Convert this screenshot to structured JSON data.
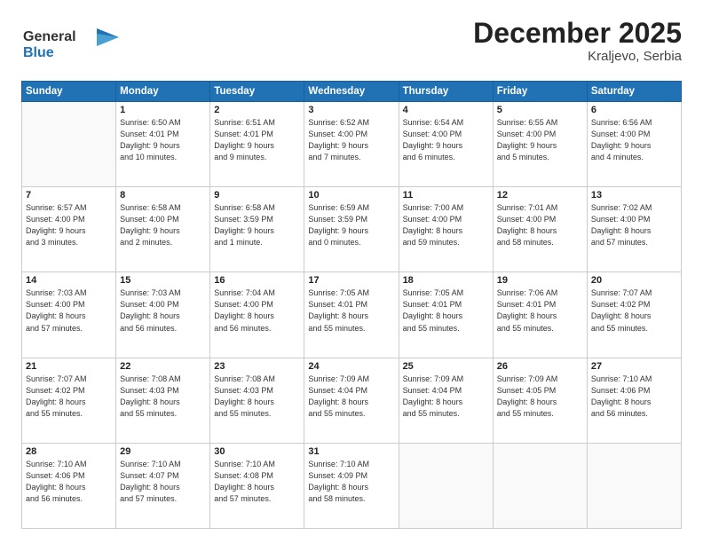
{
  "header": {
    "logo_line1": "General",
    "logo_line2": "Blue",
    "month": "December 2025",
    "location": "Kraljevo, Serbia"
  },
  "weekdays": [
    "Sunday",
    "Monday",
    "Tuesday",
    "Wednesday",
    "Thursday",
    "Friday",
    "Saturday"
  ],
  "weeks": [
    [
      {
        "day": "",
        "info": ""
      },
      {
        "day": "1",
        "info": "Sunrise: 6:50 AM\nSunset: 4:01 PM\nDaylight: 9 hours\nand 10 minutes."
      },
      {
        "day": "2",
        "info": "Sunrise: 6:51 AM\nSunset: 4:01 PM\nDaylight: 9 hours\nand 9 minutes."
      },
      {
        "day": "3",
        "info": "Sunrise: 6:52 AM\nSunset: 4:00 PM\nDaylight: 9 hours\nand 7 minutes."
      },
      {
        "day": "4",
        "info": "Sunrise: 6:54 AM\nSunset: 4:00 PM\nDaylight: 9 hours\nand 6 minutes."
      },
      {
        "day": "5",
        "info": "Sunrise: 6:55 AM\nSunset: 4:00 PM\nDaylight: 9 hours\nand 5 minutes."
      },
      {
        "day": "6",
        "info": "Sunrise: 6:56 AM\nSunset: 4:00 PM\nDaylight: 9 hours\nand 4 minutes."
      }
    ],
    [
      {
        "day": "7",
        "info": "Sunrise: 6:57 AM\nSunset: 4:00 PM\nDaylight: 9 hours\nand 3 minutes."
      },
      {
        "day": "8",
        "info": "Sunrise: 6:58 AM\nSunset: 4:00 PM\nDaylight: 9 hours\nand 2 minutes."
      },
      {
        "day": "9",
        "info": "Sunrise: 6:58 AM\nSunset: 3:59 PM\nDaylight: 9 hours\nand 1 minute."
      },
      {
        "day": "10",
        "info": "Sunrise: 6:59 AM\nSunset: 3:59 PM\nDaylight: 9 hours\nand 0 minutes."
      },
      {
        "day": "11",
        "info": "Sunrise: 7:00 AM\nSunset: 4:00 PM\nDaylight: 8 hours\nand 59 minutes."
      },
      {
        "day": "12",
        "info": "Sunrise: 7:01 AM\nSunset: 4:00 PM\nDaylight: 8 hours\nand 58 minutes."
      },
      {
        "day": "13",
        "info": "Sunrise: 7:02 AM\nSunset: 4:00 PM\nDaylight: 8 hours\nand 57 minutes."
      }
    ],
    [
      {
        "day": "14",
        "info": "Sunrise: 7:03 AM\nSunset: 4:00 PM\nDaylight: 8 hours\nand 57 minutes."
      },
      {
        "day": "15",
        "info": "Sunrise: 7:03 AM\nSunset: 4:00 PM\nDaylight: 8 hours\nand 56 minutes."
      },
      {
        "day": "16",
        "info": "Sunrise: 7:04 AM\nSunset: 4:00 PM\nDaylight: 8 hours\nand 56 minutes."
      },
      {
        "day": "17",
        "info": "Sunrise: 7:05 AM\nSunset: 4:01 PM\nDaylight: 8 hours\nand 55 minutes."
      },
      {
        "day": "18",
        "info": "Sunrise: 7:05 AM\nSunset: 4:01 PM\nDaylight: 8 hours\nand 55 minutes."
      },
      {
        "day": "19",
        "info": "Sunrise: 7:06 AM\nSunset: 4:01 PM\nDaylight: 8 hours\nand 55 minutes."
      },
      {
        "day": "20",
        "info": "Sunrise: 7:07 AM\nSunset: 4:02 PM\nDaylight: 8 hours\nand 55 minutes."
      }
    ],
    [
      {
        "day": "21",
        "info": "Sunrise: 7:07 AM\nSunset: 4:02 PM\nDaylight: 8 hours\nand 55 minutes."
      },
      {
        "day": "22",
        "info": "Sunrise: 7:08 AM\nSunset: 4:03 PM\nDaylight: 8 hours\nand 55 minutes."
      },
      {
        "day": "23",
        "info": "Sunrise: 7:08 AM\nSunset: 4:03 PM\nDaylight: 8 hours\nand 55 minutes."
      },
      {
        "day": "24",
        "info": "Sunrise: 7:09 AM\nSunset: 4:04 PM\nDaylight: 8 hours\nand 55 minutes."
      },
      {
        "day": "25",
        "info": "Sunrise: 7:09 AM\nSunset: 4:04 PM\nDaylight: 8 hours\nand 55 minutes."
      },
      {
        "day": "26",
        "info": "Sunrise: 7:09 AM\nSunset: 4:05 PM\nDaylight: 8 hours\nand 55 minutes."
      },
      {
        "day": "27",
        "info": "Sunrise: 7:10 AM\nSunset: 4:06 PM\nDaylight: 8 hours\nand 56 minutes."
      }
    ],
    [
      {
        "day": "28",
        "info": "Sunrise: 7:10 AM\nSunset: 4:06 PM\nDaylight: 8 hours\nand 56 minutes."
      },
      {
        "day": "29",
        "info": "Sunrise: 7:10 AM\nSunset: 4:07 PM\nDaylight: 8 hours\nand 57 minutes."
      },
      {
        "day": "30",
        "info": "Sunrise: 7:10 AM\nSunset: 4:08 PM\nDaylight: 8 hours\nand 57 minutes."
      },
      {
        "day": "31",
        "info": "Sunrise: 7:10 AM\nSunset: 4:09 PM\nDaylight: 8 hours\nand 58 minutes."
      },
      {
        "day": "",
        "info": ""
      },
      {
        "day": "",
        "info": ""
      },
      {
        "day": "",
        "info": ""
      }
    ]
  ]
}
